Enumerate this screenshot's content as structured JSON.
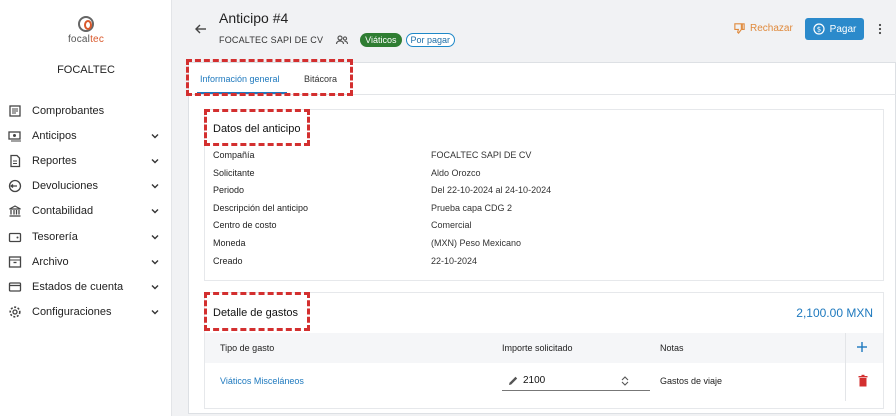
{
  "sidebar": {
    "logo": {
      "text_prefix": "focal",
      "text_accent": "tec"
    },
    "company": "FOCALTEC",
    "items": [
      {
        "label": "Comprobantes",
        "icon": "receipt-icon",
        "has_chevron": false
      },
      {
        "label": "Anticipos",
        "icon": "payments-icon",
        "has_chevron": true
      },
      {
        "label": "Reportes",
        "icon": "report-icon",
        "has_chevron": true
      },
      {
        "label": "Devoluciones",
        "icon": "return-icon",
        "has_chevron": true
      },
      {
        "label": "Contabilidad",
        "icon": "bank-icon",
        "has_chevron": true
      },
      {
        "label": "Tesorería",
        "icon": "wallet-icon",
        "has_chevron": true
      },
      {
        "label": "Archivo",
        "icon": "archive-icon",
        "has_chevron": true
      },
      {
        "label": "Estados de cuenta",
        "icon": "card-icon",
        "has_chevron": true
      },
      {
        "label": "Configuraciones",
        "icon": "gear-icon",
        "has_chevron": true
      }
    ]
  },
  "header": {
    "title": "Anticipo #4",
    "org": "FOCALTEC SAPI DE CV",
    "chip_type": "Viáticos",
    "chip_status": "Por pagar",
    "reject_label": "Rechazar",
    "pay_label": "Pagar"
  },
  "tabs": [
    {
      "label": "Información general",
      "active": true
    },
    {
      "label": "Bitácora",
      "active": false
    }
  ],
  "details": {
    "title": "Datos del anticipo",
    "rows": [
      {
        "key": "Compañía",
        "value": "FOCALTEC SAPI DE CV"
      },
      {
        "key": "Solicitante",
        "value": "Aldo Orozco"
      },
      {
        "key": "Periodo",
        "value": "Del 22-10-2024 al 24-10-2024"
      },
      {
        "key": "Descripción del anticipo",
        "value": "Prueba capa CDG 2"
      },
      {
        "key": "Centro de costo",
        "value": "Comercial"
      },
      {
        "key": "Moneda",
        "value": "(MXN) Peso Mexicano"
      },
      {
        "key": "Creado",
        "value": "22-10-2024"
      }
    ]
  },
  "expenses": {
    "title": "Detalle de gastos",
    "total": "2,100.00 MXN",
    "columns": [
      "Tipo de gasto",
      "Importe solicitado",
      "Notas"
    ],
    "rows": [
      {
        "type": "Viáticos Misceláneos",
        "amount": "2100",
        "notes": "Gastos de viaje"
      }
    ]
  },
  "colors": {
    "accent": "#1e79be",
    "pay_button": "#2b8acb",
    "reject": "#e08a3c",
    "chip_viaticos": "#2f7d32",
    "highlight_dash": "#d32f2f",
    "delete": "#d32f2f"
  }
}
